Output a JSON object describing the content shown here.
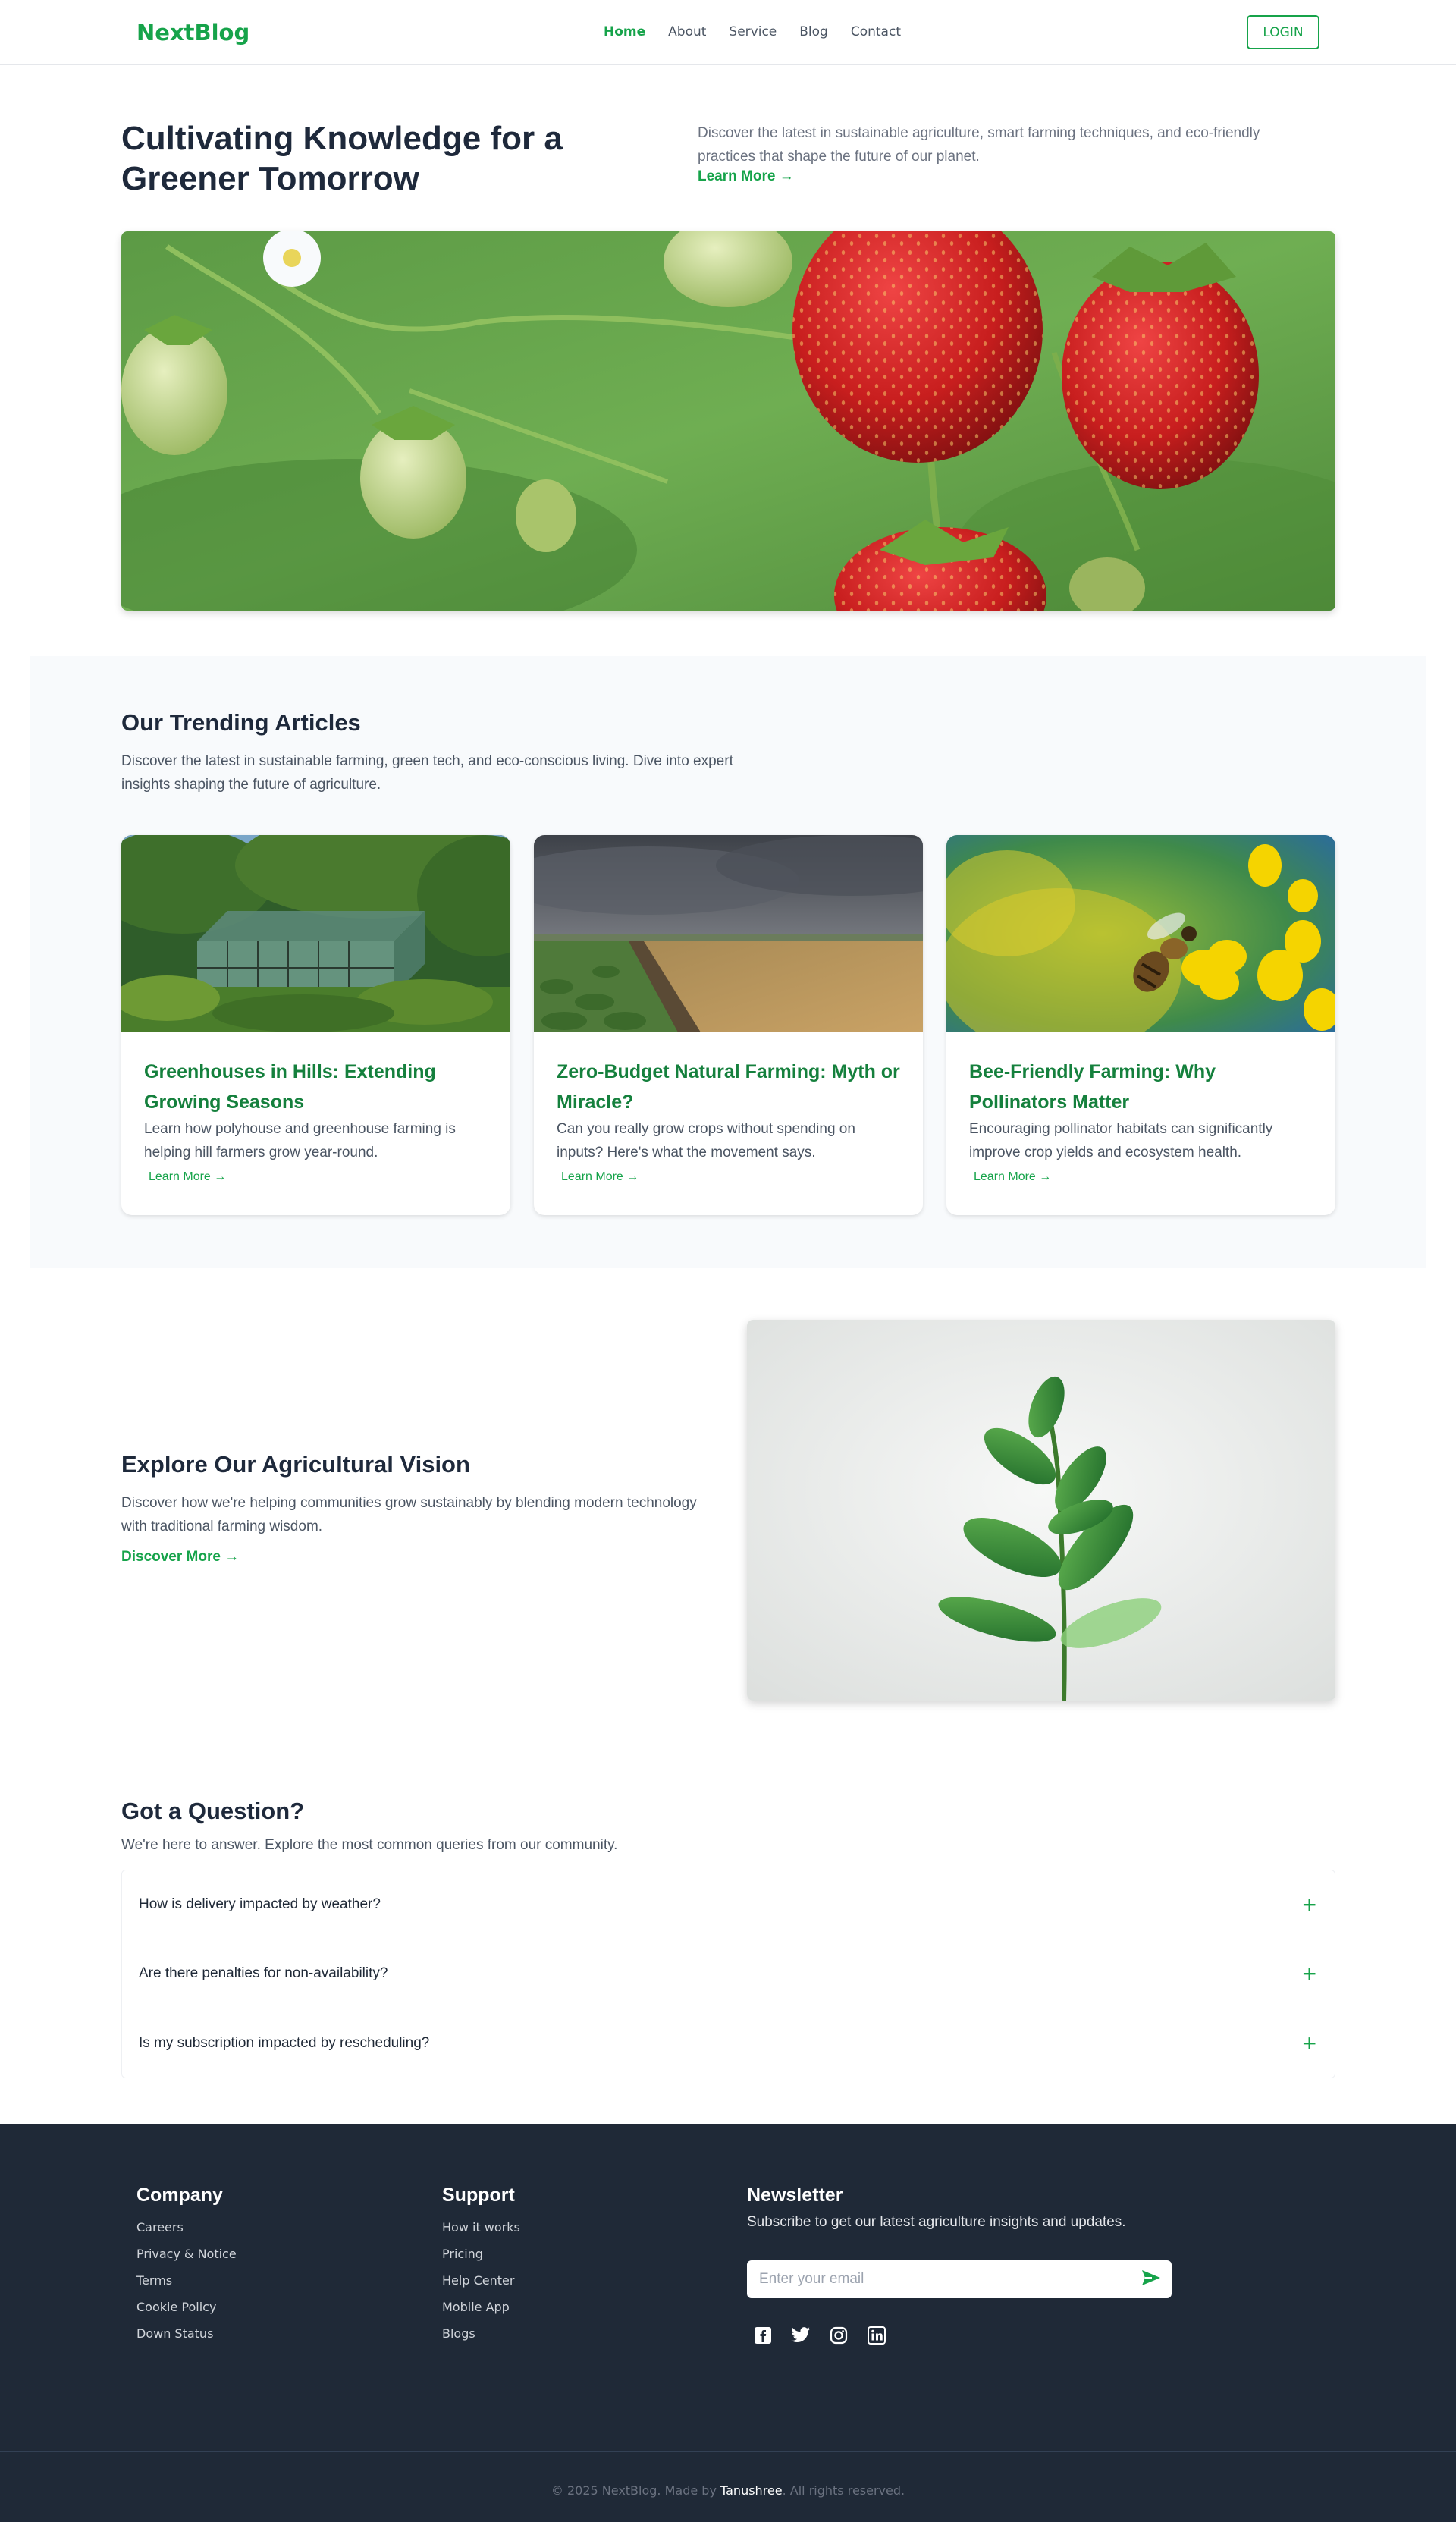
{
  "nav": {
    "logo": "NextBlog",
    "links": [
      "Home",
      "About",
      "Service",
      "Blog",
      "Contact"
    ],
    "active": "Home",
    "login_label": "LOGIN"
  },
  "hero": {
    "title": "Cultivating Knowledge for a Greener Tomorrow",
    "description": "Discover the latest in sustainable agriculture, smart farming techniques, and eco-friendly practices that shape the future of our planet.",
    "link": "Learn More →"
  },
  "trending": {
    "title": "Our Trending Articles",
    "description": "Discover the latest in sustainable farming, green tech, and eco-conscious living. Dive into expert insights shaping the future of agriculture.",
    "articles": [
      {
        "title": "Greenhouses in Hills: Extending Growing Seasons",
        "description": "Learn how polyhouse and greenhouse farming is helping hill farmers grow year-round.",
        "link": "Learn More →"
      },
      {
        "title": "Zero-Budget Natural Farming: Myth or Miracle?",
        "description": "Can you really grow crops without spending on inputs? Here's what the movement says.",
        "link": "Learn More →"
      },
      {
        "title": "Bee-Friendly Farming: Why Pollinators Matter",
        "description": "Encouraging pollinator habitats can significantly improve crop yields and ecosystem health.",
        "link": "Learn More →"
      }
    ]
  },
  "vision": {
    "title": "Explore Our Agricultural Vision",
    "description": "Discover how we're helping communities grow sustainably by blending modern technology with traditional farming wisdom.",
    "link": "Discover More →"
  },
  "faq": {
    "title": "Got a Question?",
    "subtitle": "We're here to answer. Explore the most common queries from our community.",
    "items": [
      "How is delivery impacted by weather?",
      "Are there penalties for non-availability?",
      "Is my subscription impacted by rescheduling?"
    ]
  },
  "footer": {
    "company": {
      "title": "Company",
      "links": [
        "Careers",
        "Privacy & Notice",
        "Terms",
        "Cookie Policy",
        "Down Status"
      ]
    },
    "support": {
      "title": "Support",
      "links": [
        "How it works",
        "Pricing",
        "Help Center",
        "Mobile App",
        "Blogs"
      ]
    },
    "newsletter": {
      "title": "Newsletter",
      "description": "Subscribe to get our latest agriculture insights and updates.",
      "placeholder": "Enter your email"
    },
    "socials": [
      "facebook-icon",
      "twitter-icon",
      "instagram-icon",
      "linkedin-icon"
    ],
    "copyright_prefix": "© 2025 NextBlog. Made by ",
    "copyright_author": "Tanushree",
    "copyright_suffix": ". All rights reserved."
  },
  "colors": {
    "brand": "#16a34a",
    "footer_bg": "#1f2937",
    "section_bg": "#f8fafc"
  }
}
